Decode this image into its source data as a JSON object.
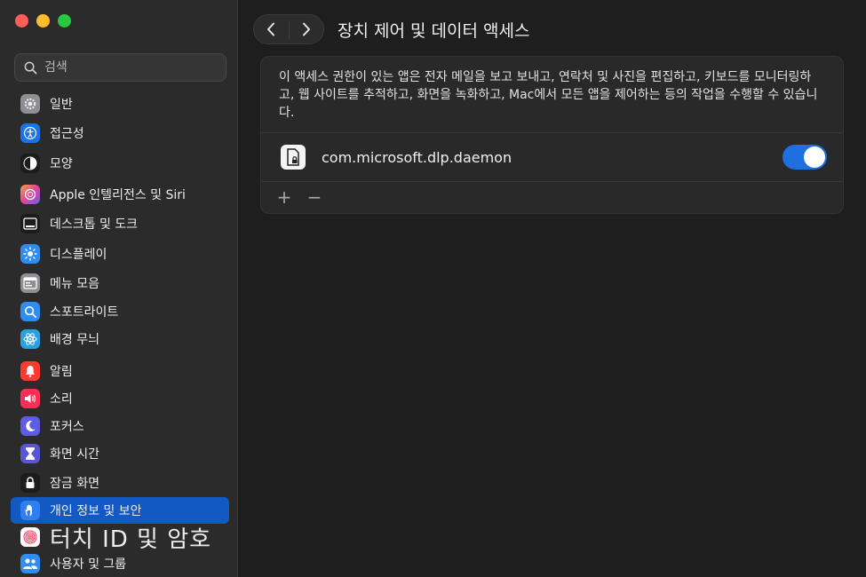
{
  "window": {
    "traffic_lights": {
      "close": "#ff5f57",
      "minimize": "#febc2e",
      "zoom": "#28c840"
    }
  },
  "search": {
    "placeholder": "검색"
  },
  "sidebar": {
    "items": [
      {
        "label": "일반",
        "icon": "gear-icon",
        "color": "#8e8e93"
      },
      {
        "label": "접근성",
        "icon": "accessibility-icon",
        "color": "#1a73e8"
      },
      {
        "label": "모양",
        "icon": "appearance-icon",
        "color": "#1c1c1e"
      },
      {
        "label": "Apple 인텔리전스 및 Siri",
        "icon": "siri-icon",
        "color": "#c34fd1"
      },
      {
        "label": "데스크톱 및 도크",
        "icon": "dock-icon",
        "color": "#1c1c1e"
      },
      {
        "label": "디스플레이",
        "icon": "sun-icon",
        "color": "#2f8cf0"
      },
      {
        "label": "메뉴 모음",
        "icon": "menubar-icon",
        "color": "#8e8e93"
      },
      {
        "label": "스포트라이트",
        "icon": "search-icon",
        "color": "#2f8cf0"
      },
      {
        "label": "배경 무늬",
        "icon": "wallpaper-icon",
        "color": "#2aa0e0"
      },
      {
        "label": "알림",
        "icon": "bell-icon",
        "color": "#ff3b30"
      },
      {
        "label": "소리",
        "icon": "speaker-icon",
        "color": "#ff2d55"
      },
      {
        "label": "포커스",
        "icon": "moon-icon",
        "color": "#5e5ce6"
      },
      {
        "label": "화면 시간",
        "icon": "hourglass-icon",
        "color": "#5856d6"
      },
      {
        "label": "잠금 화면",
        "icon": "lock-icon",
        "color": "#1c1c1e"
      },
      {
        "label": "개인 정보 및 보안",
        "icon": "hand-icon",
        "color": "#2f7ff0"
      },
      {
        "label": "터치 ID 및 암호",
        "icon": "fingerprint-icon",
        "color": "#ffffff"
      },
      {
        "label": "사용자 및 그룹",
        "icon": "users-icon",
        "color": "#2f8cf0"
      }
    ],
    "selected_index": 14
  },
  "main": {
    "title": "장치 제어 및 데이터 액세스",
    "description": "이 액세스 권한이 있는 앱은 전자 메일을 보고 보내고, 연락처 및 사진을 편집하고, 키보드를 모니터링하고, 웹 사이트를 추적하고, 화면을 녹화하고, Mac에서 모든 앱을 제어하는 등의 작업을 수행할 수 있습니다.",
    "apps": [
      {
        "name": "com.microsoft.dlp.daemon",
        "enabled": true,
        "icon": "document-lock-icon"
      }
    ],
    "add_label": "+",
    "remove_label": "−",
    "accent": "#1f6fe0"
  }
}
